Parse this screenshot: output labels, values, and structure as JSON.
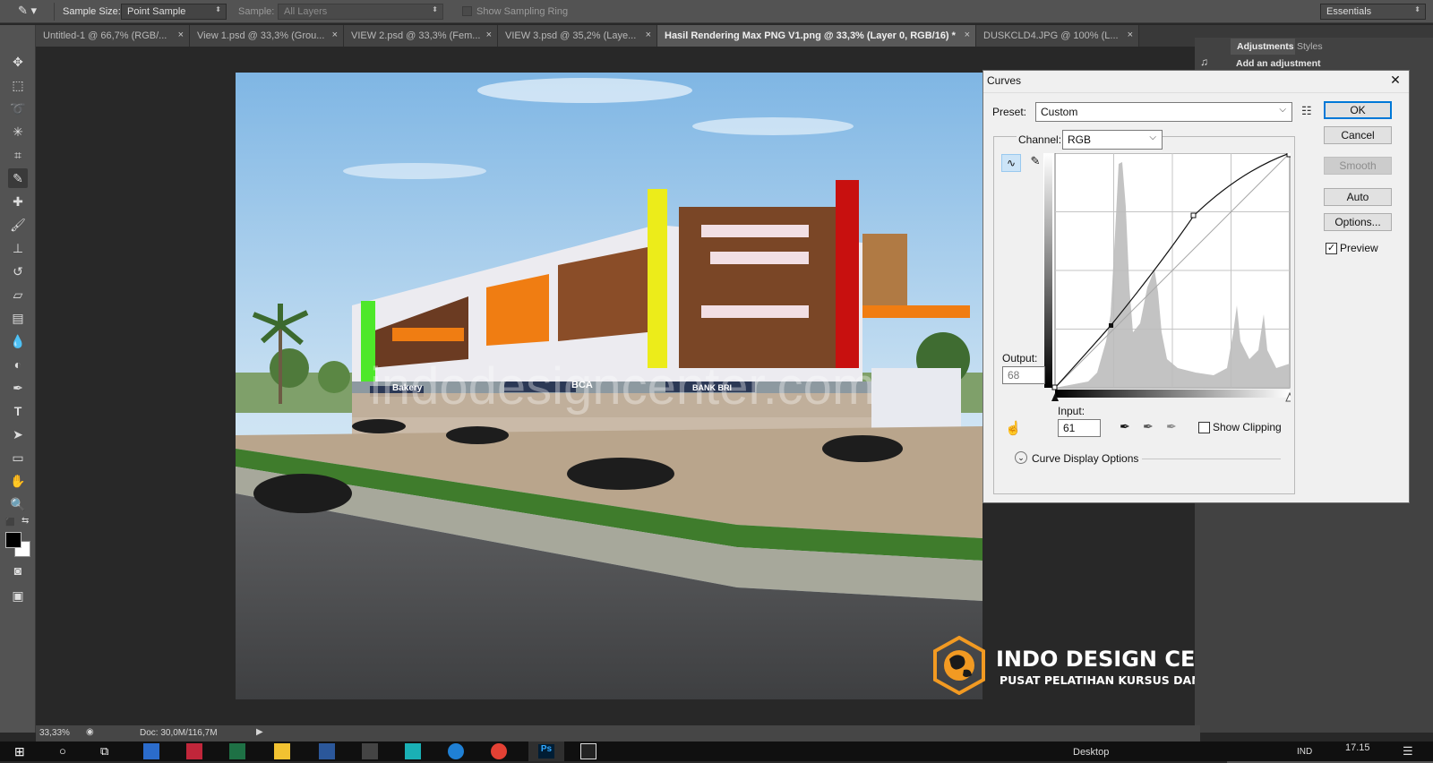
{
  "options_bar": {
    "sample_size_label": "Sample Size:",
    "sample_size_value": "Point Sample",
    "sample_label": "Sample:",
    "sample_value": "All Layers",
    "sampling_ring_label": "Show Sampling Ring",
    "workspace": "Essentials"
  },
  "tabs": [
    {
      "label": "Untitled-1 @ 66,7% (RGB/...",
      "close": "×"
    },
    {
      "label": "View 1.psd @ 33,3% (Grou...",
      "close": "×"
    },
    {
      "label": "VIEW 2.psd @ 33,3% (Fem...",
      "close": "×"
    },
    {
      "label": "VIEW 3.psd @ 35,2% (Laye...",
      "close": "×"
    },
    {
      "label": "Hasil Rendering Max PNG V1.png @ 33,3% (Layer 0, RGB/16) *",
      "close": "×"
    },
    {
      "label": "DUSKCLD4.JPG @ 100% (L...",
      "close": "×"
    }
  ],
  "canvas": {
    "watermark": "indodesigncenter.com",
    "signs": [
      "Bakery",
      "BCA",
      "BANK BRI"
    ],
    "logo_title": "INDO DESIGN CENTER",
    "logo_subtitle": "PUSAT PELATIHAN KURSUS DAN DESAIN"
  },
  "panel": {
    "tab_adjustments": "Adjustments",
    "tab_styles": "Styles",
    "add_adjustment": "Add an adjustment"
  },
  "curves": {
    "title": "Curves",
    "close": "✕",
    "preset_label": "Preset:",
    "preset_value": "Custom",
    "channel_label": "Channel:",
    "channel_value": "RGB",
    "output_label": "Output:",
    "output_value": "68",
    "input_label": "Input:",
    "input_value": "61",
    "show_clipping_label": "Show Clipping",
    "display_options_label": "Curve Display Options",
    "buttons": {
      "ok": "OK",
      "cancel": "Cancel",
      "smooth": "Smooth",
      "auto": "Auto",
      "options": "Options..."
    },
    "preview_label": "Preview",
    "preview_checked": true,
    "curve_points": [
      [
        0,
        0
      ],
      [
        61,
        68
      ],
      [
        152,
        188
      ],
      [
        255,
        255
      ]
    ]
  },
  "status_bar": {
    "zoom": "33,33%",
    "doc": "Doc: 30,0M/116,7M"
  },
  "taskbar": {
    "desktop_label": "Desktop",
    "language": "IND",
    "time": "17.15"
  }
}
